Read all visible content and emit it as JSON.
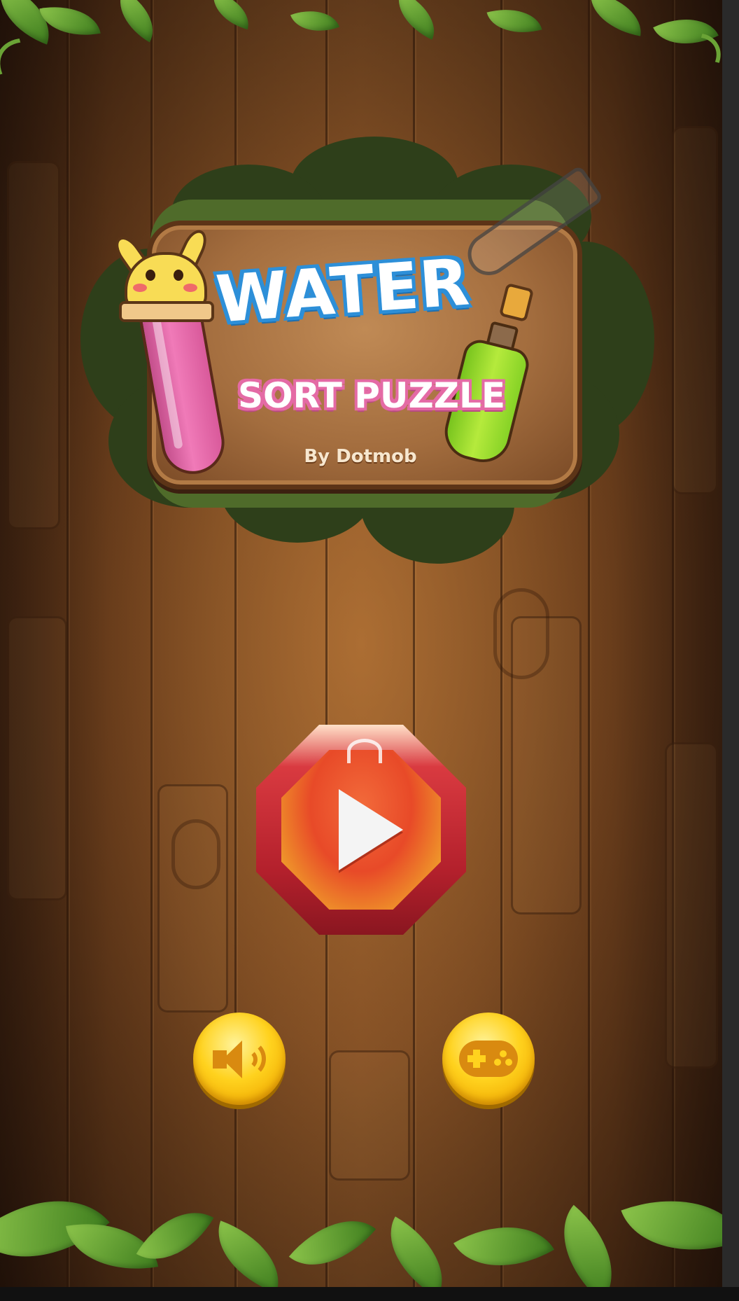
{
  "game": {
    "title_line1": "WATER",
    "title_line2": "SORT PUZZLE",
    "byline": "By Dotmob"
  },
  "buttons": {
    "play": {
      "icon": "play-icon"
    },
    "sound": {
      "icon": "speaker-icon"
    },
    "controls": {
      "icon": "gamepad-icon"
    }
  },
  "colors": {
    "title_water_fill": "#ffffff",
    "title_water_outline": "#2d8fd8",
    "title_sort_outline": "#e46aa5",
    "play_button_red": "#d93a40",
    "round_button_yellow": "#ffd21e",
    "pink_liquid": "#f07ab8",
    "green_liquid": "#b5ea3c"
  }
}
